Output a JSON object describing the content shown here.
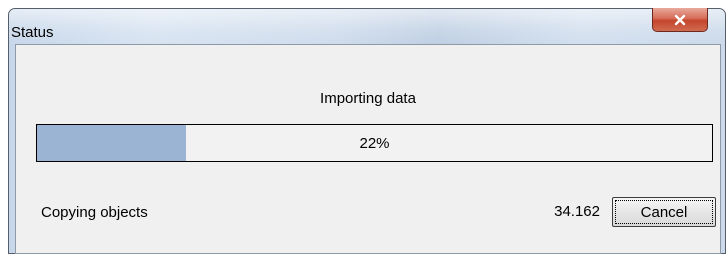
{
  "window": {
    "title": "Status"
  },
  "dialog": {
    "heading": "Importing data",
    "progress": {
      "fraction": 0.22,
      "label": "22%"
    },
    "status_text": "Copying objects",
    "count": "34.162",
    "cancel_label": "Cancel"
  },
  "colors": {
    "progress_fill": "#9bb4d4",
    "close_button": "#c4452c"
  },
  "icons": {
    "close": "close-icon"
  }
}
